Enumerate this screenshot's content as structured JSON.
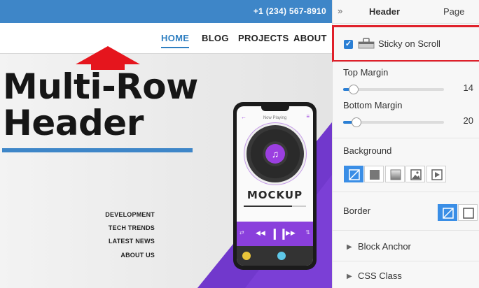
{
  "preview": {
    "phone_number": "+1 (234) 567-8910",
    "nav": [
      "HOME",
      "BLOG",
      "PROJECTS",
      "ABOUT"
    ],
    "hero_title_line1": "Multi-Row",
    "hero_title_line2": "Header",
    "side_links": [
      "DEVELOPMENT",
      "TECH TRENDS",
      "LATEST NEWS",
      "ABOUT US"
    ],
    "mockup": {
      "now_playing": "Now Playing",
      "word": "MOCKUP",
      "progress": 0.78
    },
    "colors": {
      "top_bar": "#3e86c8",
      "accent": "#2f7fc1",
      "purple": "#7b3fd6",
      "arrow": "#e5151d"
    }
  },
  "panel": {
    "tabs": {
      "header": "Header",
      "page": "Page"
    },
    "sticky": {
      "label": "Sticky on Scroll",
      "checked": true
    },
    "top_margin": {
      "label": "Top Margin",
      "value": "14",
      "fraction": 0.06
    },
    "bottom_margin": {
      "label": "Bottom Margin",
      "value": "20",
      "fraction": 0.09
    },
    "background": {
      "label": "Background",
      "options": [
        "none-icon",
        "color-icon",
        "gradient-icon",
        "image-icon",
        "video-icon"
      ],
      "selected": "none-icon"
    },
    "border": {
      "label": "Border",
      "options": [
        "none-icon",
        "box-icon"
      ],
      "selected": "none-icon"
    },
    "block_anchor": "Block Anchor",
    "css_class": "CSS Class",
    "highlight_color": "#e0202a"
  }
}
